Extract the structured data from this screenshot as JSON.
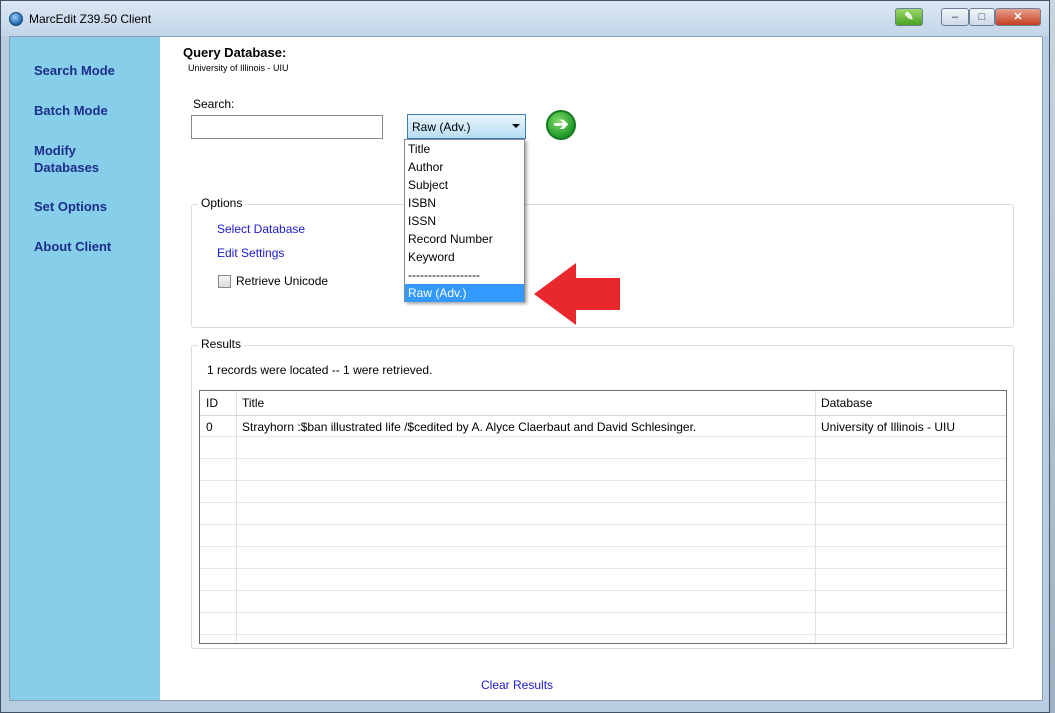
{
  "window": {
    "title": "MarcEdit Z39.50 Client"
  },
  "sidebar": {
    "items": [
      {
        "label": "Search Mode"
      },
      {
        "label": "Batch Mode"
      },
      {
        "label": "Modify Databases"
      },
      {
        "label": "Set Options"
      },
      {
        "label": "About Client"
      }
    ]
  },
  "query": {
    "title": "Query Database:",
    "database_name": "University of Illinois - UIU",
    "search_label": "Search:",
    "search_value": "",
    "search_type_selected": "Raw (Adv.)",
    "search_type_options": [
      "Title",
      "Author",
      "Subject",
      "ISBN",
      "ISSN",
      "Record Number",
      "Keyword",
      "------------------",
      "Raw (Adv.)"
    ]
  },
  "options": {
    "legend": "Options",
    "select_database": "Select Database",
    "edit_settings": "Edit Settings",
    "retrieve_unicode_label": "Retrieve Unicode",
    "retrieve_unicode_checked": false
  },
  "results": {
    "legend": "Results",
    "status": "1 records were located -- 1 were retrieved.",
    "columns": [
      "ID",
      "Title",
      "Database"
    ],
    "rows": [
      [
        "0",
        "Strayhorn :$ban illustrated life /$cedited by A. Alyce Claerbaut and David Schlesinger.",
        "University of Illinois - UIU"
      ]
    ]
  },
  "footer": {
    "clear_results": "Clear Results"
  },
  "colors": {
    "sidebar": "#87ceeb",
    "link": "#1a1ad0",
    "annotation_arrow": "#e8282d",
    "selected": "#3399ff"
  },
  "icons": {
    "go": "arrow-right-circle-icon",
    "app": "globe-icon"
  }
}
